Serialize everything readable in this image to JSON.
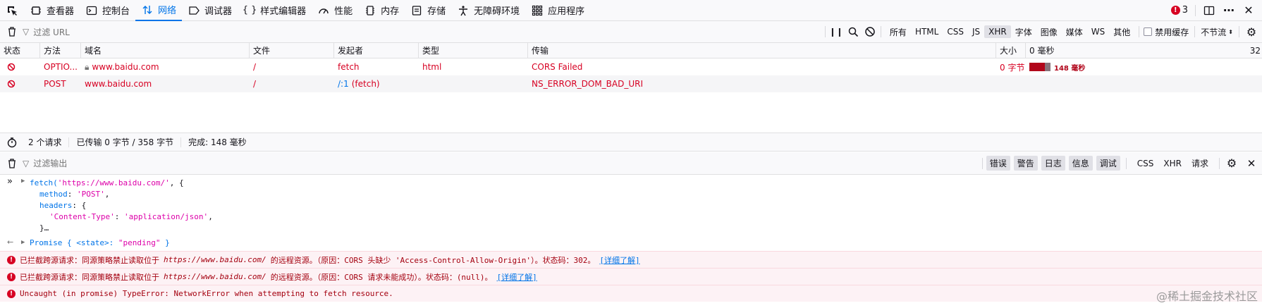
{
  "toolbar": {
    "tools": [
      "查看器",
      "控制台",
      "网络",
      "调试器",
      "样式编辑器",
      "性能",
      "内存",
      "存储",
      "无障碍环境",
      "应用程序"
    ],
    "error_count": "3"
  },
  "net_filter": {
    "placeholder": "过滤 URL",
    "types": [
      "所有",
      "HTML",
      "CSS",
      "JS",
      "XHR",
      "字体",
      "图像",
      "媒体",
      "WS",
      "其他"
    ],
    "selected_type": "XHR",
    "disable_cache": "禁用缓存",
    "throttle": "不节流"
  },
  "table": {
    "headers": [
      "状态",
      "方法",
      "域名",
      "文件",
      "发起者",
      "类型",
      "传输",
      "大小",
      "0 毫秒",
      "32"
    ],
    "rows": [
      {
        "method": "OPTIO...",
        "domain": "www.baidu.com",
        "file": "/",
        "initiator": "fetch",
        "type": "html",
        "transfer": "CORS Failed",
        "size": "0 字节",
        "waterfall": "148 毫秒"
      },
      {
        "method": "POST",
        "domain": "www.baidu.com",
        "file": "/",
        "initiator_link": "/:1",
        "initiator": "(fetch)",
        "type": "",
        "transfer": "NS_ERROR_DOM_BAD_URI",
        "size": "",
        "waterfall": ""
      }
    ]
  },
  "summary": {
    "requests": "2 个请求",
    "transferred": "已传输 0 字节 / 358 字节",
    "finish": "完成: 148 毫秒"
  },
  "console_filter": {
    "placeholder": "过滤输出",
    "levels": [
      "错误",
      "警告",
      "日志",
      "信息",
      "调试"
    ],
    "extras": [
      "CSS",
      "XHR",
      "请求"
    ]
  },
  "console": {
    "input": {
      "l1_fn": "fetch(",
      "l1_str": "'https://www.baidu.com/'",
      "l1_rest": ", {",
      "l2_key": "method",
      "l2_val": "'POST'",
      "l3_key": "headers",
      "l3_rest": ": {",
      "l4_key": "'Content-Type'",
      "l4_val": "'application/json'",
      "l5": "}…"
    },
    "result": {
      "prefix": "Promise { <state>: ",
      "state": "\"pending\"",
      "suffix": " }"
    },
    "errors": [
      {
        "pre": "已拦截跨源请求：同源策略禁止读取位于",
        "url": "https://www.baidu.com/",
        "post": "的远程资源。（原因：CORS 头缺少 'Access-Control-Allow-Origin'）。状态码：302。",
        "link": "[详细了解]"
      },
      {
        "pre": "已拦截跨源请求：同源策略禁止读取位于",
        "url": "https://www.baidu.com/",
        "post": "的远程资源。（原因：CORS 请求未能成功）。状态码：(null)。",
        "link": "[详细了解]"
      },
      {
        "pre": "Uncaught (in promise) TypeError: NetworkError when attempting to fetch resource.",
        "url": "",
        "post": "",
        "link": ""
      }
    ]
  },
  "watermark": "@稀土掘金技术社区"
}
